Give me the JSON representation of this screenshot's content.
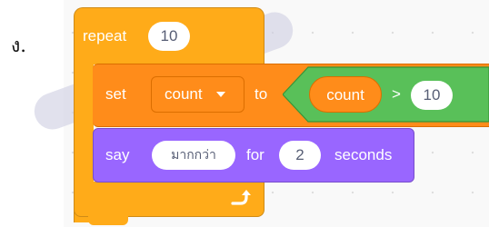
{
  "option_label": "ง.",
  "repeat_block": {
    "label": "repeat",
    "count": "10",
    "loop_arrow_icon": "loop-arrow-icon"
  },
  "set_block": {
    "label": "set",
    "variable": "count",
    "to_label": "to",
    "condition": {
      "left": "count",
      "operator": ">",
      "right": "10"
    }
  },
  "say_block": {
    "label": "say",
    "message": "มากกว่า",
    "for_label": "for",
    "seconds_value": "2",
    "seconds_label": "seconds"
  },
  "colors": {
    "control": "#ffab19",
    "variables": "#ff8c1a",
    "operators": "#59c059",
    "looks": "#9966ff"
  }
}
